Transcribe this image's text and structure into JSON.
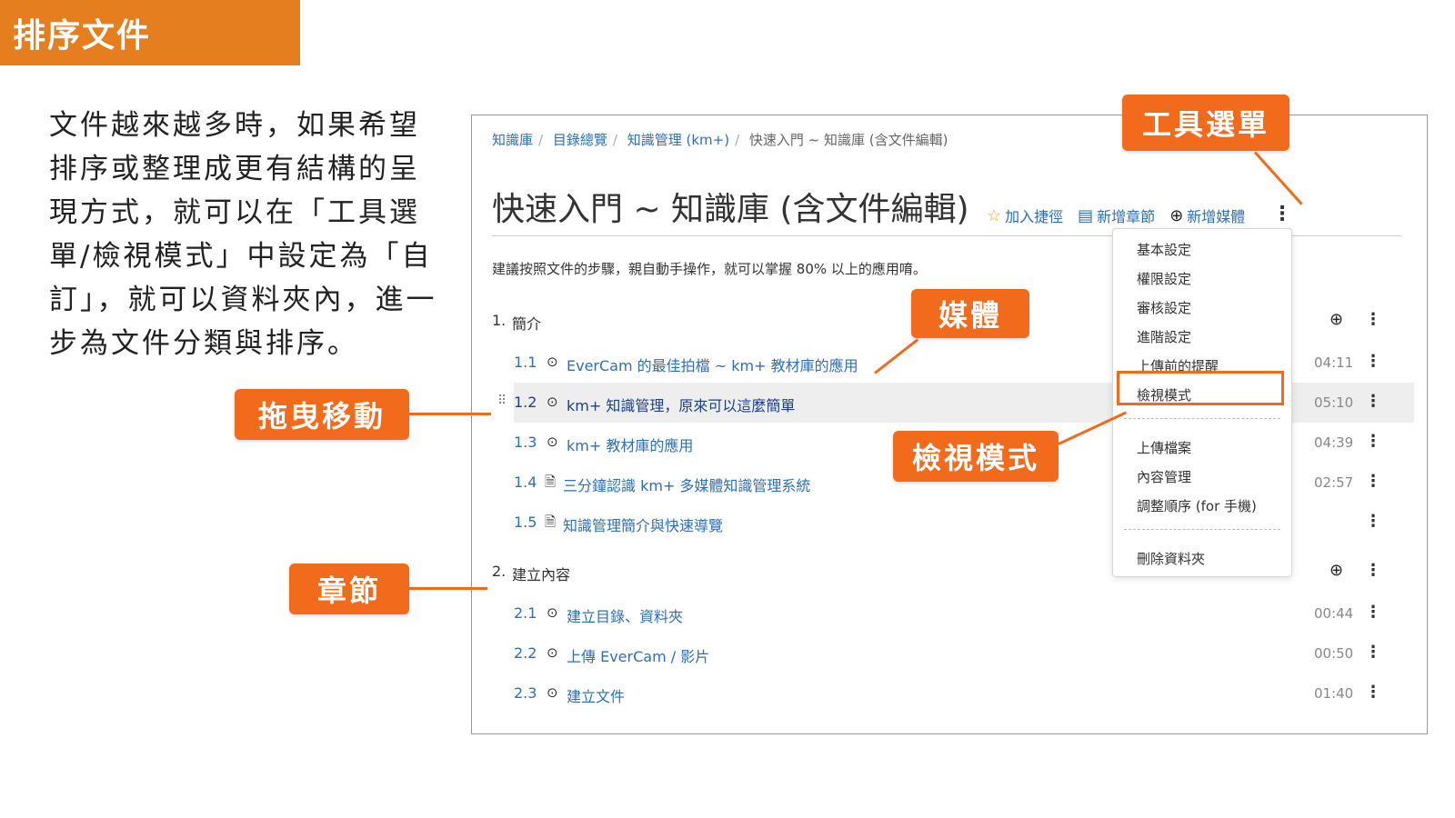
{
  "slide": {
    "title": "排序文件",
    "intro": "文件越來越多時，如果希望排序或整理成更有結構的呈現方式，就可以在「工具選單/檢視模式」中設定為「自訂」，就可以資料夾內，進一步為文件分類與排序。",
    "accent_color": "#f26b1d"
  },
  "callouts": {
    "tools_menu": "工具選單",
    "media": "媒體",
    "drag": "拖曳移動",
    "view_mode": "檢視模式",
    "chapter": "章節"
  },
  "breadcrumb": {
    "items": [
      "知識庫",
      "目錄總覽",
      "知識管理 (km+)"
    ],
    "current": "快速入門 ~ 知識庫 (含文件編輯)"
  },
  "page": {
    "title": "快速入門 ~ 知識庫 (含文件編輯)",
    "description": "建議按照文件的步驟，親自動手操作，就可以掌握 80% 以上的應用唷。"
  },
  "toolbar": {
    "shortcut": "加入捷徑",
    "add_chapter": "新增章節",
    "add_media": "新增媒體"
  },
  "chapters": [
    {
      "number": "1.",
      "title": "簡介",
      "items": [
        {
          "number": "1.1",
          "type": "video",
          "title": "EverCam 的最佳拍檔 ~ km+ 教材庫的應用",
          "duration": "04:11"
        },
        {
          "number": "1.2",
          "type": "video",
          "title": "km+ 知識管理，原來可以這麼簡單",
          "duration": "05:10"
        },
        {
          "number": "1.3",
          "type": "video",
          "title": "km+ 教材庫的應用",
          "duration": "04:39"
        },
        {
          "number": "1.4",
          "type": "doc",
          "title": "三分鐘認識 km+ 多媒體知識管理系統",
          "duration": "02:57"
        },
        {
          "number": "1.5",
          "type": "doc",
          "title": "知識管理簡介與快速導覽",
          "duration": ""
        }
      ]
    },
    {
      "number": "2.",
      "title": "建立內容",
      "items": [
        {
          "number": "2.1",
          "type": "video",
          "title": "建立目錄、資料夾",
          "duration": "00:44"
        },
        {
          "number": "2.2",
          "type": "video",
          "title": "上傳 EverCam / 影片",
          "duration": "00:50"
        },
        {
          "number": "2.3",
          "type": "video",
          "title": "建立文件",
          "duration": "01:40"
        }
      ]
    }
  ],
  "menu": {
    "group1": [
      "基本設定",
      "權限設定",
      "審核設定",
      "進階設定",
      "上傳前的提醒",
      "檢視模式"
    ],
    "group2": [
      "上傳檔案",
      "內容管理",
      "調整順序 (for 手機)"
    ],
    "group3": [
      "刪除資料夾"
    ],
    "selected": "檢視模式"
  }
}
